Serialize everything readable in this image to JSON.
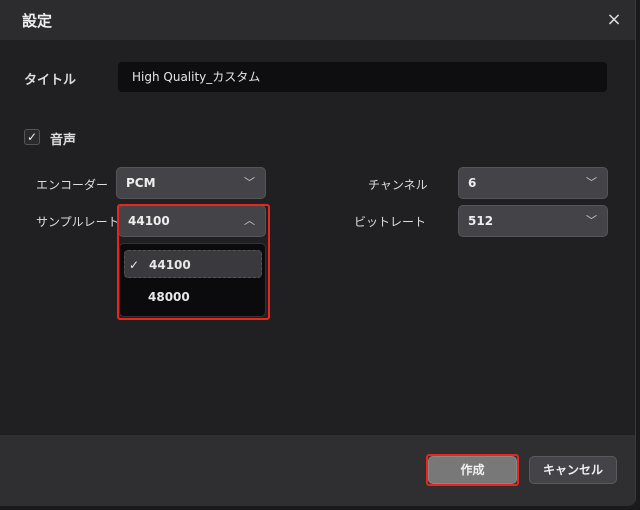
{
  "dialog": {
    "title": "設定",
    "close_icon": "×"
  },
  "title_field": {
    "label": "タイトル",
    "value": "High Quality_カスタム"
  },
  "audio": {
    "label": "音声",
    "checked": true
  },
  "encoder": {
    "label": "エンコーダー",
    "value": "PCM"
  },
  "sample_rate": {
    "label": "サンプルレート",
    "value": "44100",
    "options": [
      "44100",
      "48000"
    ],
    "selected": "44100"
  },
  "channel": {
    "label": "チャンネル",
    "value": "6"
  },
  "bitrate": {
    "label": "ビットレート",
    "value": "512"
  },
  "footer": {
    "create_label": "作成",
    "cancel_label": "キャンセル"
  },
  "colors": {
    "highlight": "#e8261e",
    "background": "#202022"
  }
}
